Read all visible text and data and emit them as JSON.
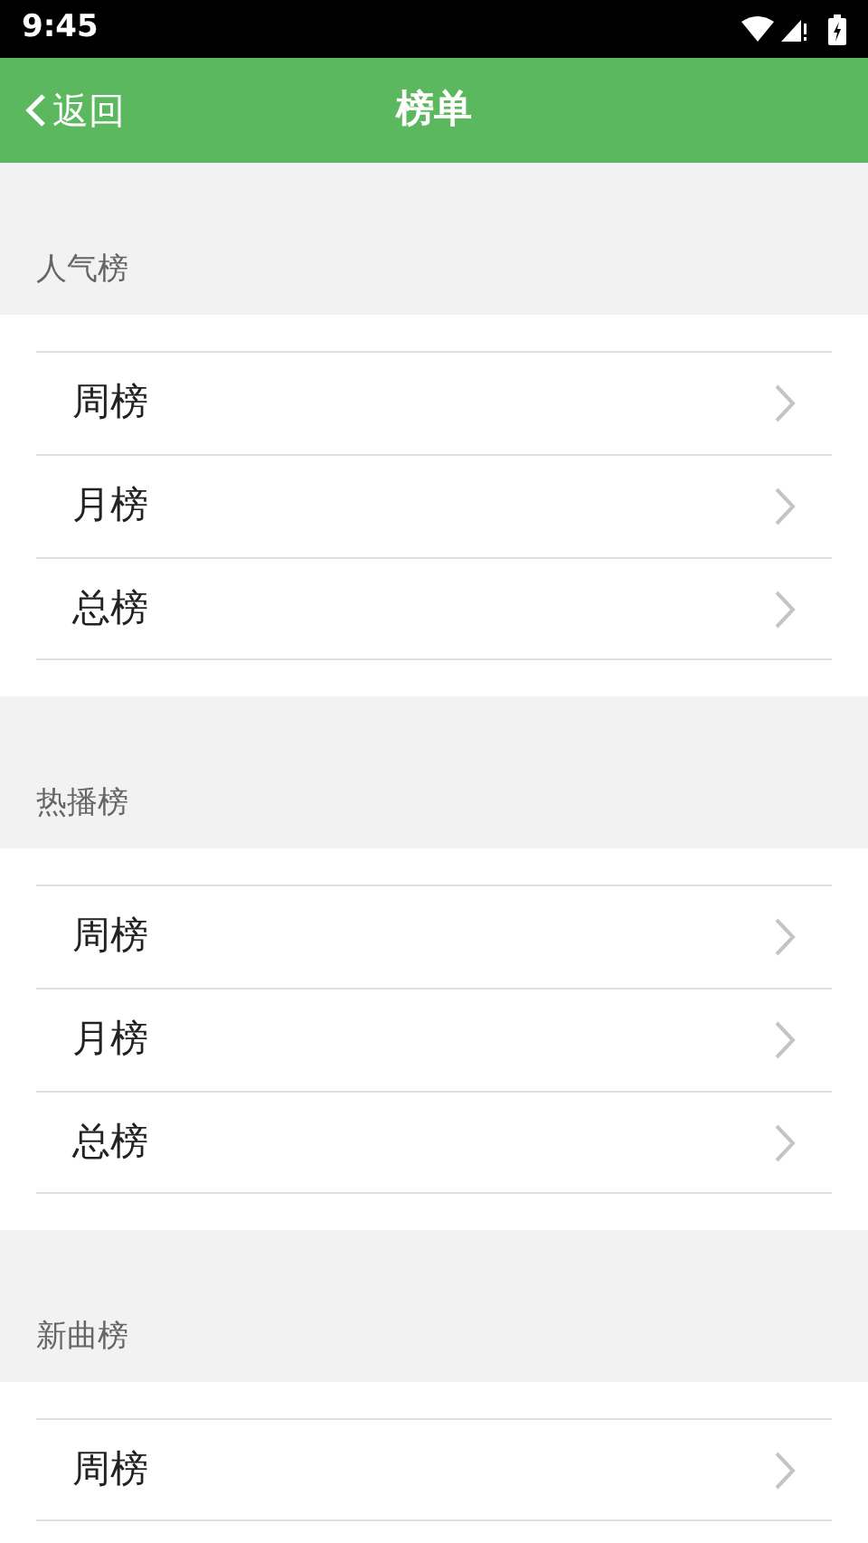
{
  "status_bar": {
    "time": "9:45"
  },
  "header": {
    "back": "返回",
    "title": "榜单"
  },
  "sections": [
    {
      "title": "人气榜",
      "items": [
        "周榜",
        "月榜",
        "总榜"
      ]
    },
    {
      "title": "热播榜",
      "items": [
        "周榜",
        "月榜",
        "总榜"
      ]
    },
    {
      "title": "新曲榜",
      "items": [
        "周榜"
      ]
    }
  ]
}
